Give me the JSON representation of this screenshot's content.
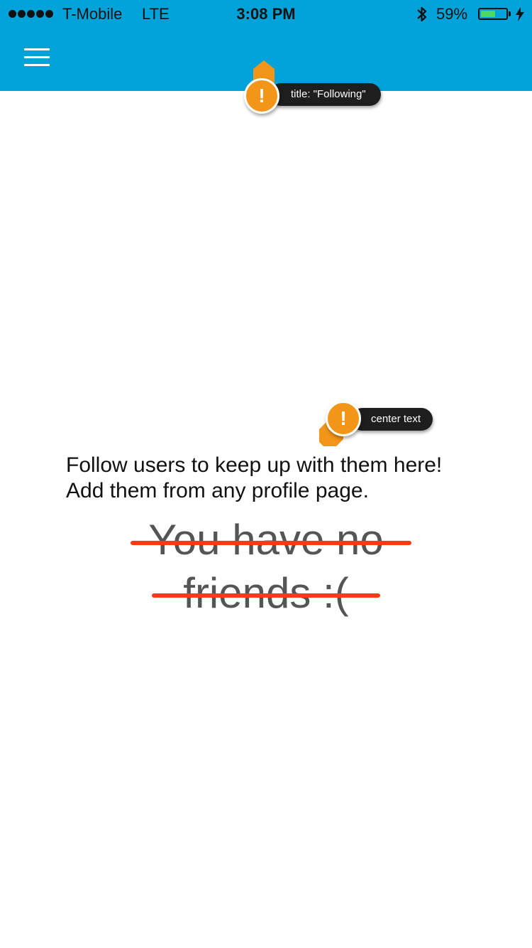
{
  "status_bar": {
    "carrier": "T-Mobile",
    "network": "LTE",
    "time": "3:08 PM",
    "battery_percent": "59%",
    "battery_level": 0.59,
    "icons": [
      "signal-dots-icon",
      "bluetooth-icon",
      "battery-icon",
      "charging-bolt-icon"
    ]
  },
  "header": {
    "background_color": "#00a3d9",
    "menu_icon": "hamburger-menu-icon"
  },
  "annotations": {
    "title_note": "title: \"Following\"",
    "center_note": "center text",
    "note_color": "#f29518",
    "note_mark": "!"
  },
  "main": {
    "message_line1": "Follow users to keep up with them here!",
    "message_line2": "Add them from any profile page.",
    "struck_line1": "You have no",
    "struck_line2": "friends :(",
    "strike_color": "#ff3a12"
  }
}
